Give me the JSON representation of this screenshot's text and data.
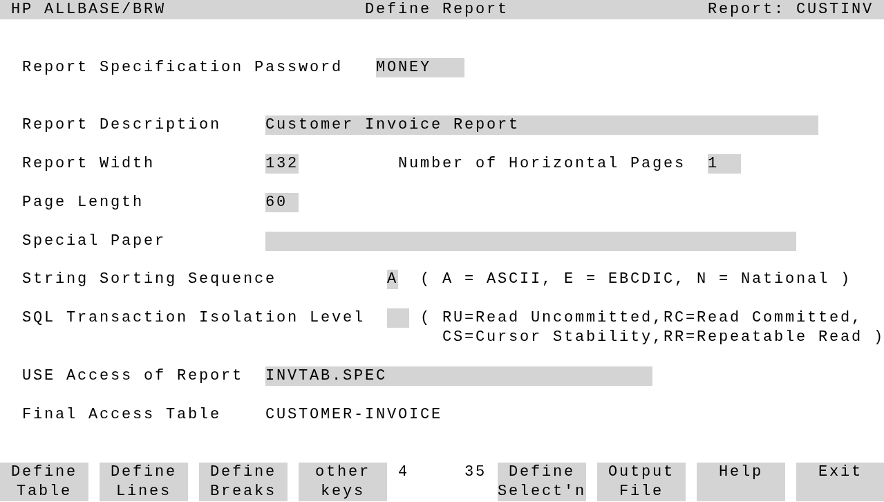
{
  "header": {
    "product": "HP ALLBASE/BRW",
    "screen": "Define Report",
    "report": "Report: CUSTINV"
  },
  "fields": [
    {
      "label": "Report Specification Password",
      "kind": "input",
      "value": "MONEY"
    },
    {
      "label": "Report Description",
      "kind": "input",
      "value": "Customer Invoice Report"
    },
    {
      "label": "Report Width",
      "kind": "input",
      "value": "132"
    },
    {
      "label": "Number of Horizontal Pages",
      "kind": "input",
      "value": "1"
    },
    {
      "label": "Page Length",
      "kind": "input",
      "value": "60"
    },
    {
      "label": "Special Paper",
      "kind": "input"
    },
    {
      "label": "String Sorting Sequence",
      "kind": "input",
      "value": "A",
      "hints": [
        "( A = ASCII, E = EBCDIC, N = National )"
      ]
    },
    {
      "label": "SQL Transaction Isolation Level",
      "kind": "input",
      "hints": [
        "( RU=Read Uncommitted,RC=Read Committed,",
        "CS=Cursor Stability,RR=Repeatable Read )"
      ]
    },
    {
      "label": "USE Access of Report",
      "kind": "input",
      "value": "INVTAB.SPEC"
    },
    {
      "label": "Final Access Table",
      "kind": "display",
      "value": "CUSTOMER-INVOICE"
    }
  ],
  "function_keys": [
    {
      "lines": [
        "Define",
        "Table"
      ]
    },
    {
      "lines": [
        "Define",
        "Lines"
      ]
    },
    {
      "lines": [
        "Define",
        "Breaks"
      ]
    },
    {
      "lines": [
        "other",
        "keys"
      ]
    },
    {
      "lines": [
        "Define",
        "Select'n"
      ]
    },
    {
      "lines": [
        "Output",
        "File"
      ]
    },
    {
      "lines": [
        "Help"
      ]
    },
    {
      "lines": [
        "Exit"
      ]
    }
  ],
  "status": [
    "4",
    "35"
  ]
}
